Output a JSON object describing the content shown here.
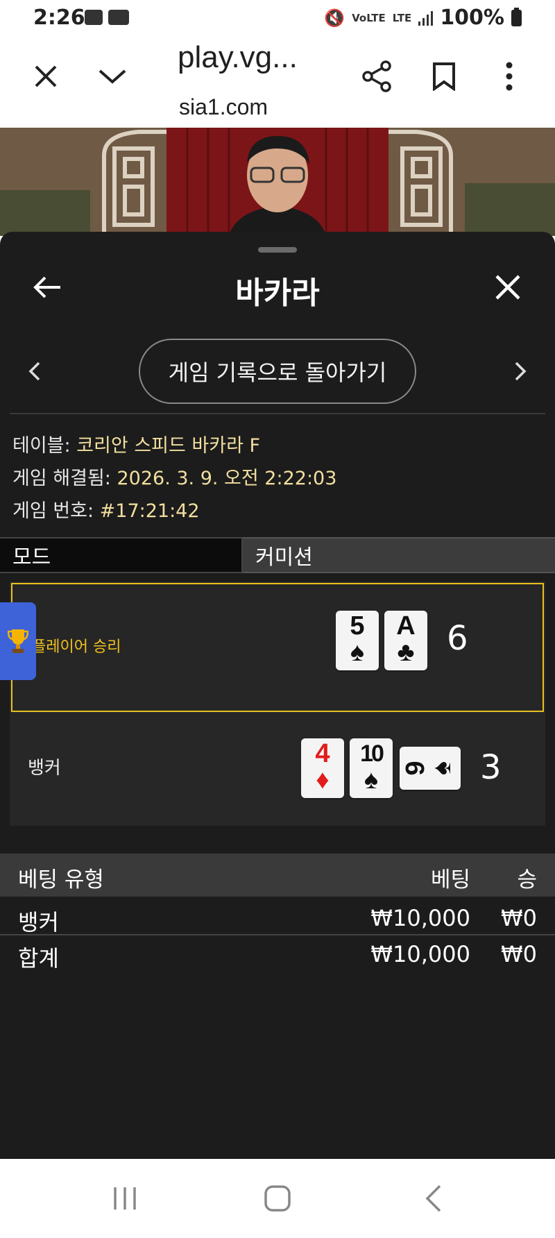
{
  "status_bar": {
    "time": "2:26",
    "network": "LTE",
    "battery": "100%",
    "icons": [
      "image-icon",
      "youtube-icon",
      "mute-icon",
      "volte-icon",
      "signal-icon",
      "battery-icon"
    ]
  },
  "browser": {
    "url_title": "play.vg...",
    "url_domain": "sia1.com"
  },
  "sheet": {
    "title": "바카라",
    "history_button": "게임 기록으로 돌아가기",
    "table_label": "테이블:",
    "table_value": "코리안 스피드 바카라 F",
    "resolved_label": "게임 해결됨:",
    "resolved_value": "2026. 3. 9. 오전 2:22:03",
    "game_no_label": "게임 번호:",
    "game_no_value": "#17:21:42",
    "tabs": [
      "모드",
      "커미션"
    ]
  },
  "hands": {
    "player": {
      "label": "플레이어 승리",
      "score": "6",
      "cards": [
        {
          "rank": "5",
          "suit": "♠"
        },
        {
          "rank": "A",
          "suit": "♣"
        }
      ]
    },
    "banker": {
      "label": "뱅커",
      "score": "3",
      "cards": [
        {
          "rank": "4",
          "suit": "♦"
        },
        {
          "rank": "10",
          "suit": "♠"
        },
        {
          "rank": "9",
          "suit": "♠"
        }
      ]
    }
  },
  "bets": {
    "headers": {
      "type": "베팅 유형",
      "bet": "베팅",
      "win": "승"
    },
    "rows": [
      {
        "type": "뱅커",
        "bet": "₩10,000",
        "win": "₩0"
      }
    ],
    "total": {
      "type": "합계",
      "bet": "₩10,000",
      "win": "₩0"
    }
  },
  "colors": {
    "sheet_bg": "#1c1c1c",
    "accent_gold": "#e8c21c",
    "value_text": "#f3dfa0",
    "trophy_tab": "#3e62d8"
  }
}
